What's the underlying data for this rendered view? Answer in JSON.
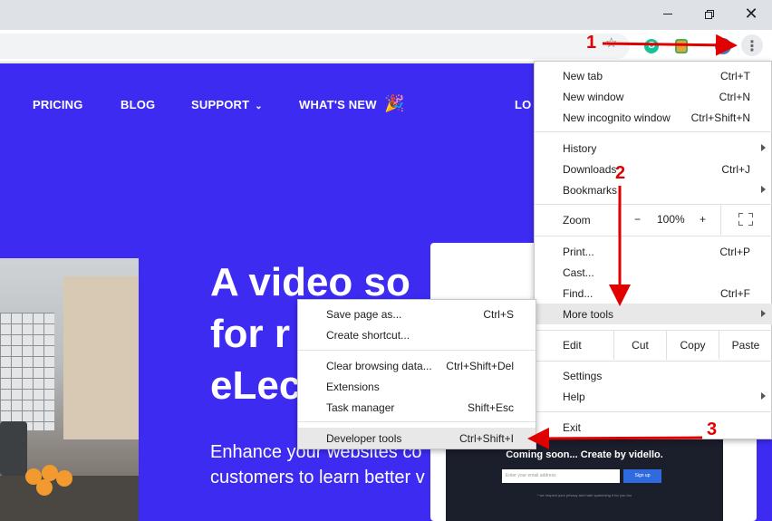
{
  "nav": {
    "pricing": "PRICING",
    "blog": "BLOG",
    "support": "SUPPORT",
    "whats_new": "WHAT'S NEW",
    "login": "LO"
  },
  "hero": {
    "headline_1": "A video so",
    "headline_2": "for r",
    "headline_3": "eLec",
    "subline_1": "Enhance your websites co",
    "subline_2": "customers to learn better v"
  },
  "preview": {
    "title": "Coming soon... Create by vidello.",
    "input_placeholder": "Enter your email address",
    "button": "Sign up",
    "note": "* we respect your privacy and hate spamming it for you too"
  },
  "menu": {
    "new_tab": {
      "label": "New tab",
      "shortcut": "Ctrl+T"
    },
    "new_window": {
      "label": "New window",
      "shortcut": "Ctrl+N"
    },
    "new_incognito": {
      "label": "New incognito window",
      "shortcut": "Ctrl+Shift+N"
    },
    "history": {
      "label": "History"
    },
    "downloads": {
      "label": "Downloads",
      "shortcut": "Ctrl+J"
    },
    "bookmarks": {
      "label": "Bookmarks"
    },
    "zoom": {
      "label": "Zoom",
      "minus": "−",
      "value": "100%",
      "plus": "+"
    },
    "print": {
      "label": "Print...",
      "shortcut": "Ctrl+P"
    },
    "cast": {
      "label": "Cast..."
    },
    "find": {
      "label": "Find...",
      "shortcut": "Ctrl+F"
    },
    "more_tools": {
      "label": "More tools"
    },
    "edit": {
      "label": "Edit",
      "cut": "Cut",
      "copy": "Copy",
      "paste": "Paste"
    },
    "settings": {
      "label": "Settings"
    },
    "help": {
      "label": "Help"
    },
    "exit": {
      "label": "Exit"
    }
  },
  "submenu": {
    "save_page": {
      "label": "Save page as...",
      "shortcut": "Ctrl+S"
    },
    "create_shortcut": {
      "label": "Create shortcut..."
    },
    "clear_data": {
      "label": "Clear browsing data...",
      "shortcut": "Ctrl+Shift+Del"
    },
    "extensions": {
      "label": "Extensions"
    },
    "task_manager": {
      "label": "Task manager",
      "shortcut": "Shift+Esc"
    },
    "dev_tools": {
      "label": "Developer tools",
      "shortcut": "Ctrl+Shift+I"
    }
  },
  "annotations": {
    "step1": "1",
    "step2": "2",
    "step3": "3"
  },
  "colors": {
    "hero_bg": "#3d2bf2",
    "annotation": "#e00000",
    "menu_highlight": "#e8e8e8"
  },
  "icons": {
    "star": "star-icon",
    "grammarly": "grammarly-icon",
    "extension": "extension-icon",
    "profile": "avatar",
    "menu": "kebab-menu-icon",
    "fullscreen": "fullscreen-icon",
    "party": "party-popper-icon"
  }
}
